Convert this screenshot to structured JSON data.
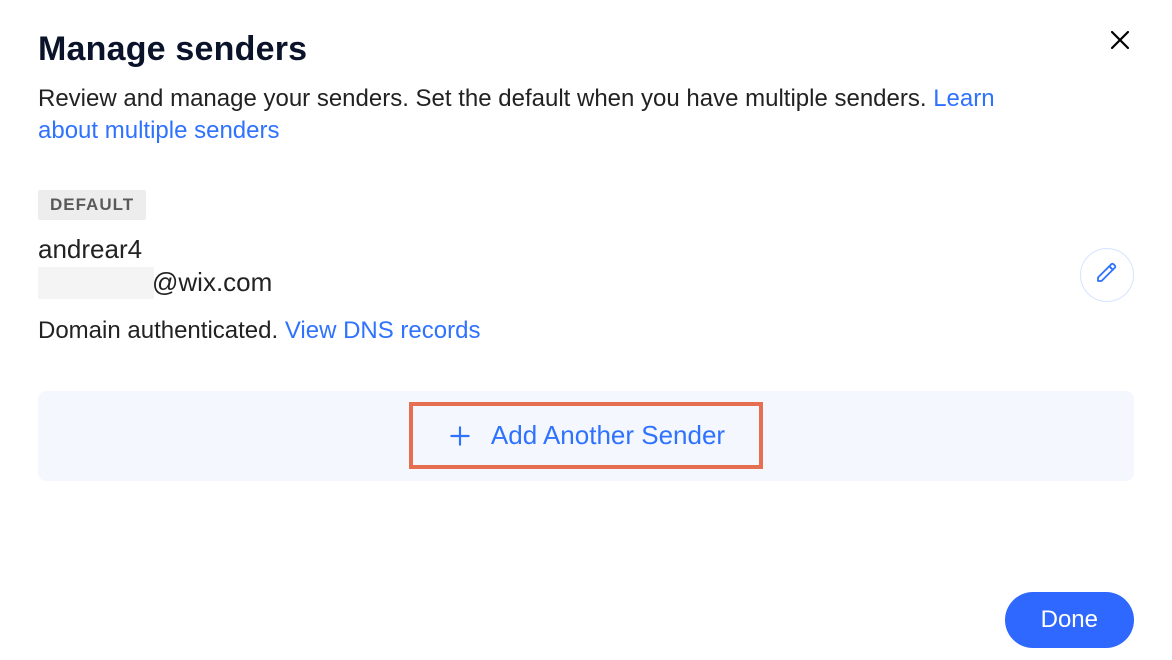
{
  "header": {
    "title": "Manage senders",
    "subtitle_prefix": "Review and manage your senders. Set the default when you have multiple senders. ",
    "subtitle_link": "Learn about multiple senders"
  },
  "badge": {
    "label": "DEFAULT"
  },
  "sender": {
    "name": "andrear4",
    "email_suffix": "@wix.com",
    "auth_status": "Domain authenticated. ",
    "dns_link": "View DNS records"
  },
  "actions": {
    "add_label": "Add Another Sender",
    "done_label": "Done"
  }
}
